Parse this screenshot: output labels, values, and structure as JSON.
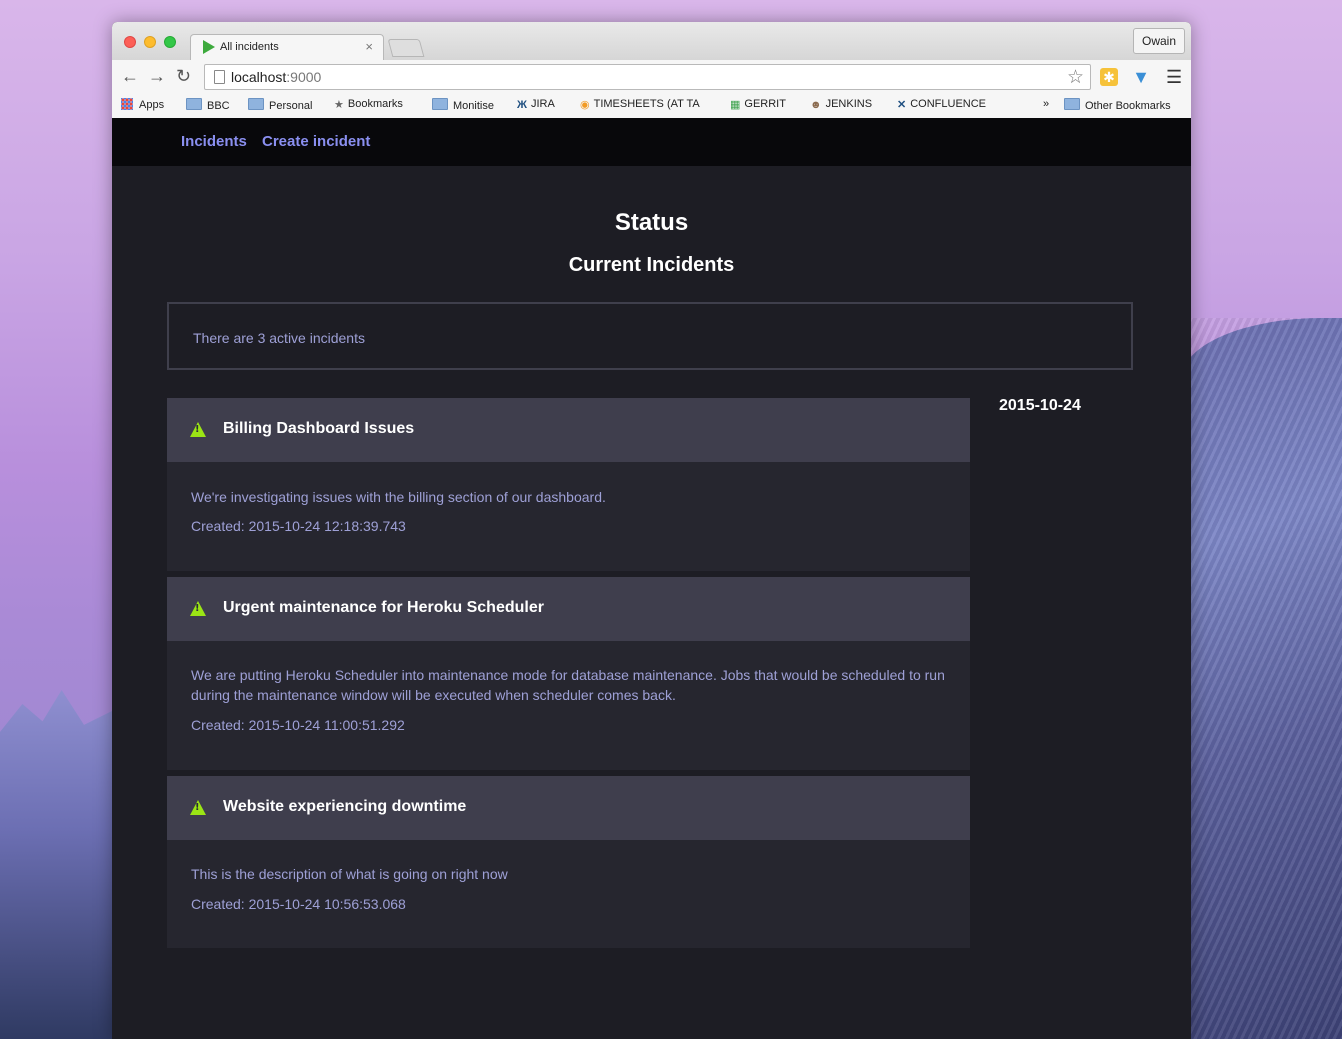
{
  "browser": {
    "tab_title": "All incidents",
    "tab_close": "×",
    "profile_name": "Owain",
    "url_host": "localhost",
    "url_port": ":9000",
    "bookmarks": [
      {
        "label": "Apps"
      },
      {
        "label": "BBC"
      },
      {
        "label": "Personal"
      },
      {
        "label": "Bookmarks"
      },
      {
        "label": "Monitise"
      },
      {
        "label": "JIRA"
      },
      {
        "label": "TIMESHEETS (AT TA"
      },
      {
        "label": "GERRIT"
      },
      {
        "label": "JENKINS"
      },
      {
        "label": "CONFLUENCE"
      },
      {
        "label": "»"
      },
      {
        "label": "Other Bookmarks"
      }
    ]
  },
  "nav": {
    "incidents": "Incidents",
    "create": "Create incident"
  },
  "page": {
    "status_heading": "Status",
    "current_heading": "Current Incidents",
    "summary": "There are 3 active incidents",
    "date": "2015-10-24"
  },
  "incidents": [
    {
      "title": "Billing Dashboard Issues",
      "description": "We're investigating issues with the billing section of our dashboard.",
      "created": "Created: 2015-10-24 12:18:39.743"
    },
    {
      "title": "Urgent maintenance for Heroku Scheduler",
      "description": "We are putting Heroku Scheduler into maintenance mode for database maintenance. Jobs that would be scheduled to run during the maintenance window will be executed when scheduler comes back.",
      "created": "Created: 2015-10-24 11:00:51.292"
    },
    {
      "title": "Website experiencing downtime",
      "description": "This is the description of what is going on right now",
      "created": "Created: 2015-10-24 10:56:53.068"
    }
  ],
  "colors": {
    "accent_link": "#8a8ff0",
    "warning": "#9be515",
    "muted_text": "#9ea0d6",
    "panel_header": "#3f3e4d",
    "panel_body": "#26262f"
  }
}
